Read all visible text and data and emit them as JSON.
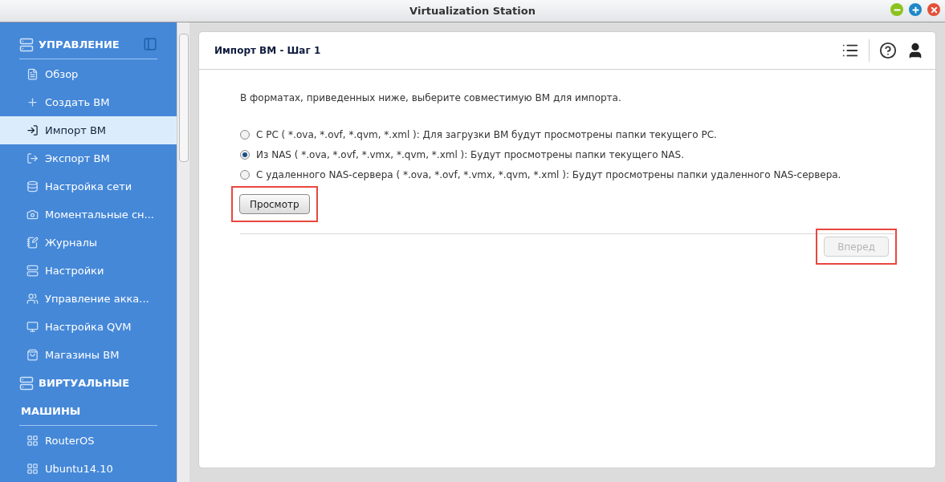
{
  "window": {
    "title": "Virtualization Station"
  },
  "sidebar": {
    "sections": [
      {
        "title_lines": [
          "УПРАВЛЕНИЕ"
        ],
        "items": [
          {
            "label": "Обзор",
            "selected": false
          },
          {
            "label": "Создать ВМ",
            "selected": false
          },
          {
            "label": "Импорт ВМ",
            "selected": true
          },
          {
            "label": "Экспорт ВМ",
            "selected": false
          },
          {
            "label": "Настройка сети",
            "selected": false
          },
          {
            "label": "Моментальные сн...",
            "selected": false
          },
          {
            "label": "Журналы",
            "selected": false
          },
          {
            "label": "Настройки",
            "selected": false
          },
          {
            "label": "Управление акка...",
            "selected": false
          },
          {
            "label": "Настройка QVM",
            "selected": false
          },
          {
            "label": "Магазины ВМ",
            "selected": false
          }
        ]
      },
      {
        "title_lines": [
          "ВИРТУАЛЬНЫЕ",
          "МАШИНЫ"
        ],
        "items": [
          {
            "label": "RouterOS",
            "selected": false
          },
          {
            "label": "Ubuntu14.10",
            "selected": false
          }
        ]
      }
    ]
  },
  "panel": {
    "title": "Импорт ВМ - Шаг 1",
    "intro": "В форматах, приведенных ниже, выберите совместимую ВМ для импорта.",
    "options": [
      {
        "label": "С PC  ( *.ova, *.ovf, *.qvm, *.xml ): Для загрузки ВМ будут просмотрены папки текущего PC.",
        "selected": false
      },
      {
        "label": "Из NAS  ( *.ova, *.ovf, *.vmx, *.qvm, *.xml ): Будут просмотрены папки текущего NAS.",
        "selected": true
      },
      {
        "label": "С удаленного NAS-сервера  ( *.ova, *.ovf, *.vmx, *.qvm, *.xml ): Будут просмотрены папки удаленного NAS-сервера.",
        "selected": false
      }
    ],
    "browse_button": {
      "label": "Просмотр",
      "disabled": false,
      "highlighted": true
    },
    "next_button": {
      "label": "Вперед",
      "disabled": true,
      "highlighted": true
    }
  }
}
